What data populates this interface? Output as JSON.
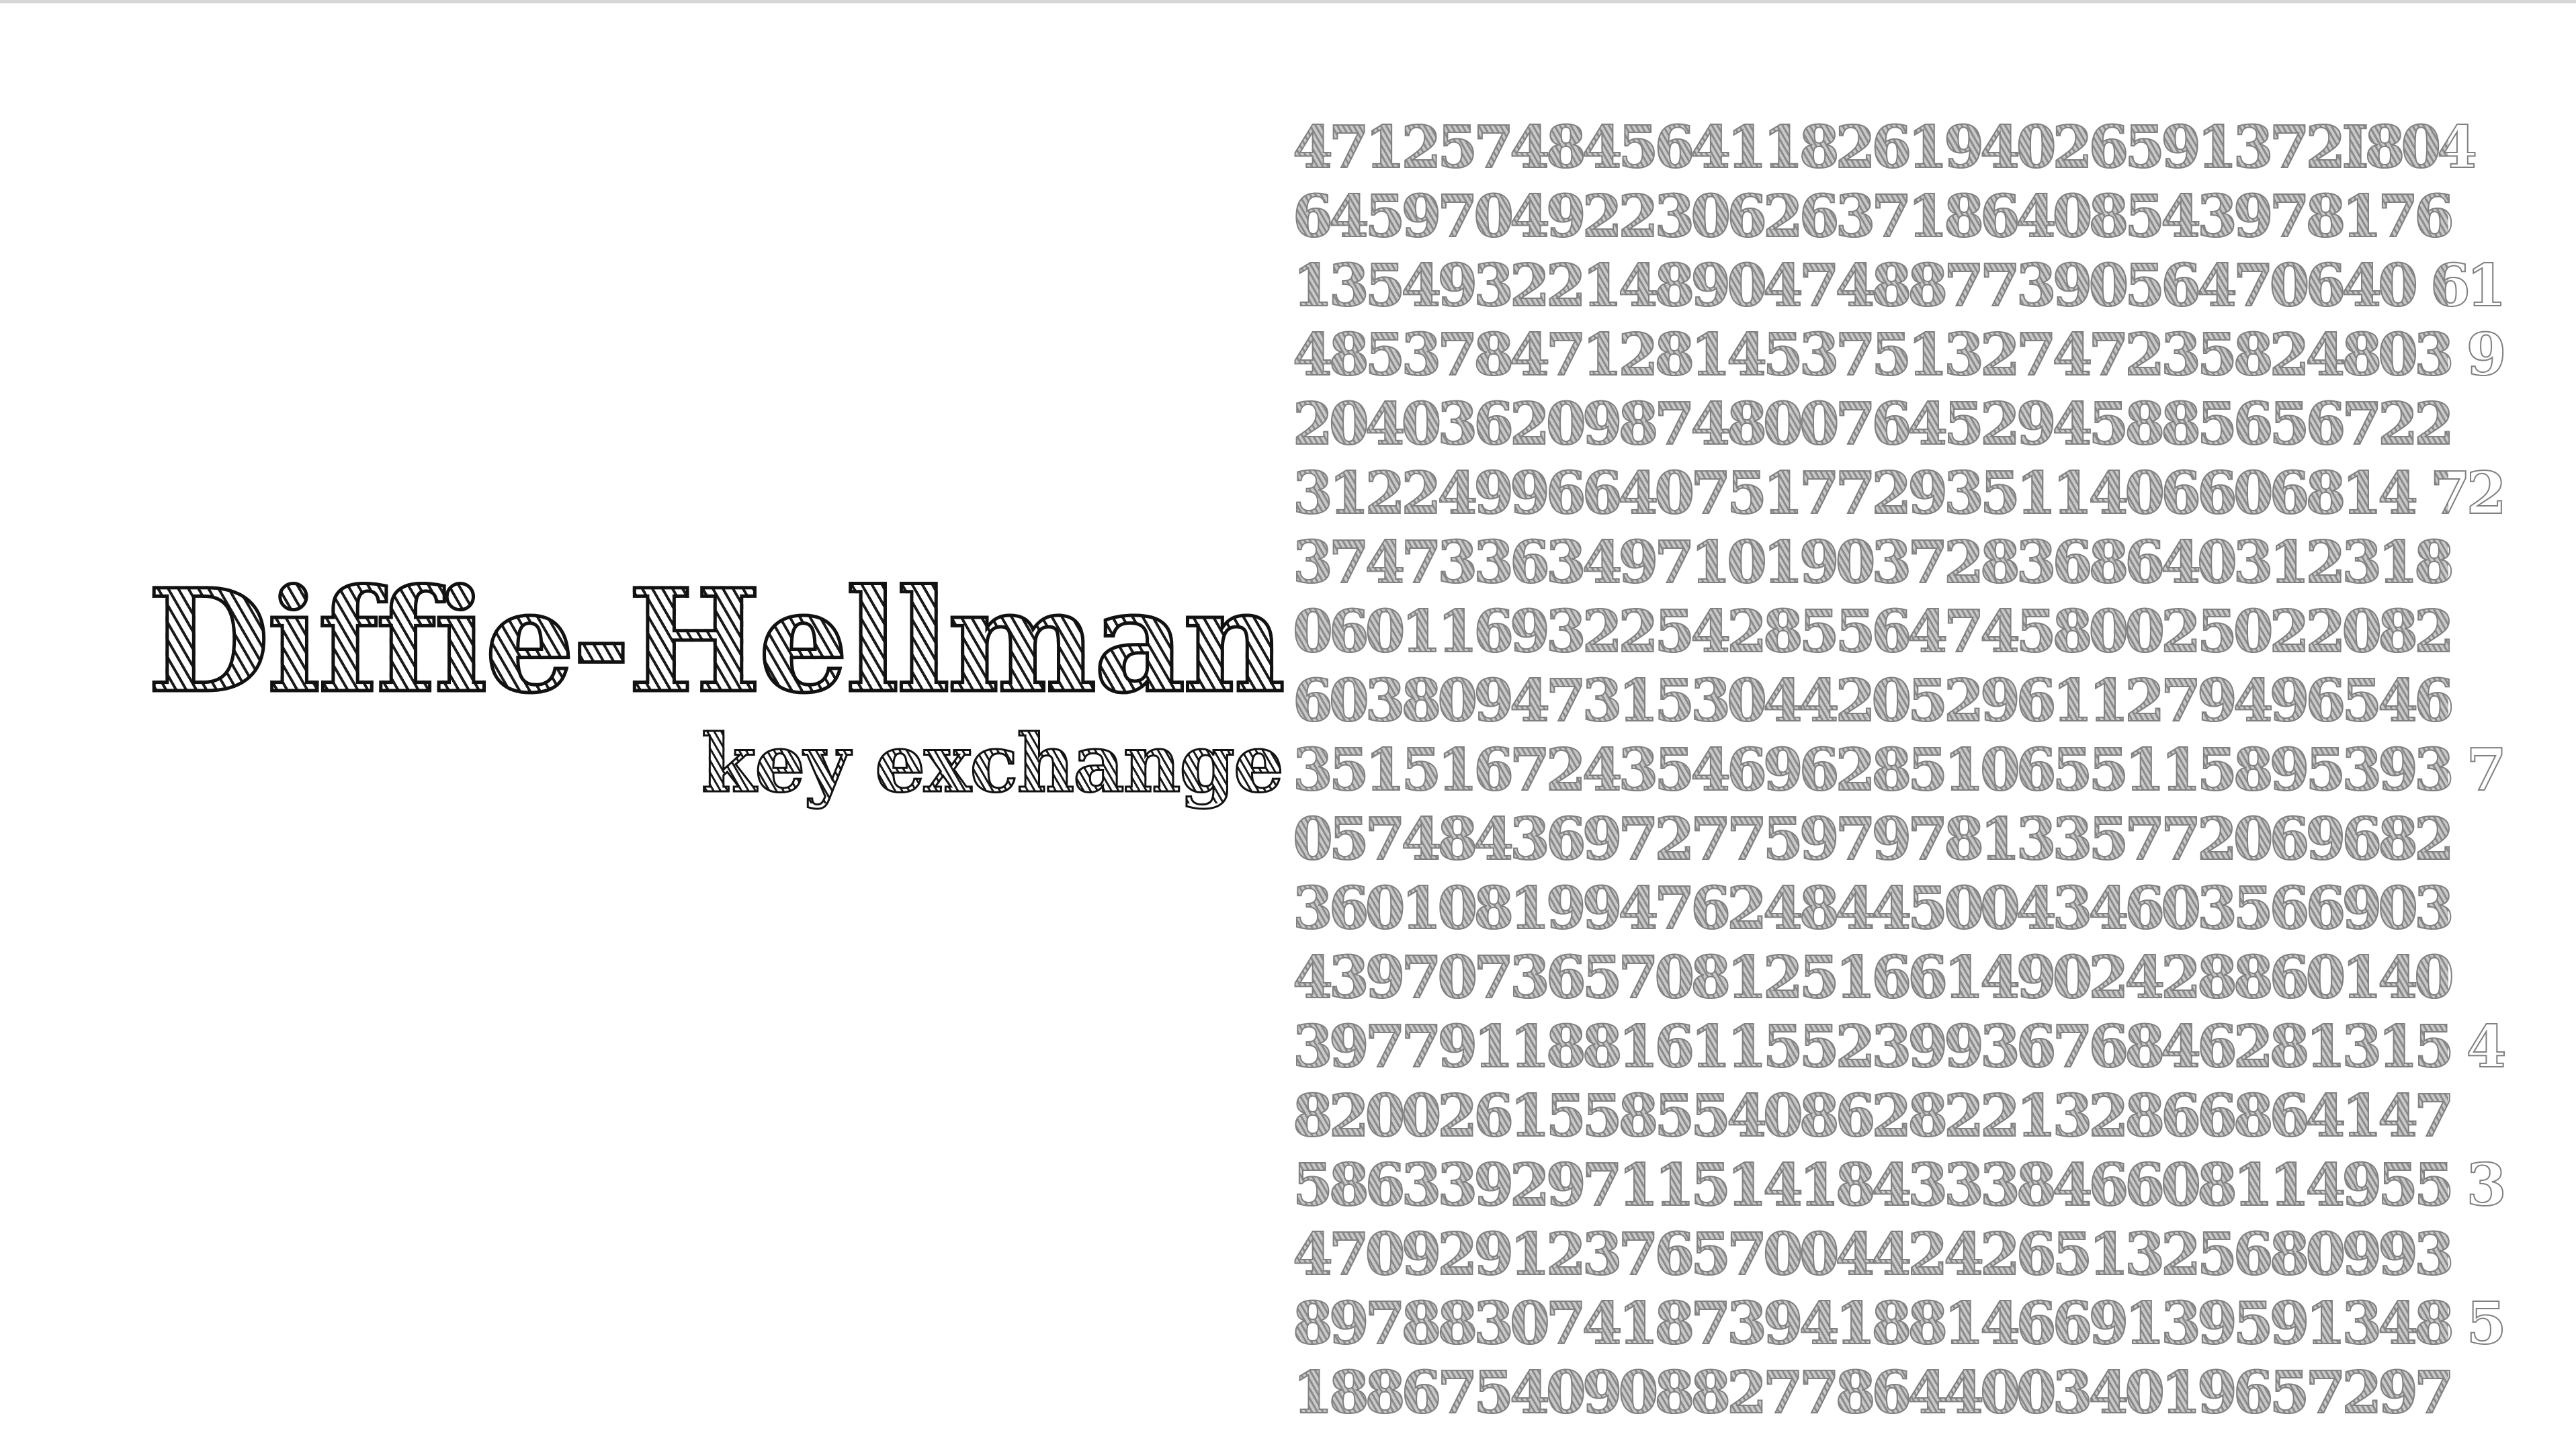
{
  "title": "Diffie-Hellman",
  "subtitle": "key exchange",
  "number_lines": [
    "47125748456411826194026591372I804",
    "64597049223062637186408543978176",
    "1354932214890474887739056470640 61",
    "48537847128145375132747235824803 9",
    "20403620987480076452945885656722",
    "3122499664075177293511406606814 72",
    "37473363497101903728368640312318",
    "06011693225428556474580025022082",
    "60380947315304420529611279496546",
    "35151672435469628510655115895393 7",
    "05748436972775979781335772069682",
    "36010819947624844500434603566903",
    "43970736570812516614902428860140",
    "39779118816115523993676846281315 4",
    "82002615585540862822132866864147",
    "58633929711514184333846608114955 3",
    "47092912376570044242651325680993",
    "89788307418739418814669139591348 5",
    "18867540908827786440034019657297"
  ]
}
